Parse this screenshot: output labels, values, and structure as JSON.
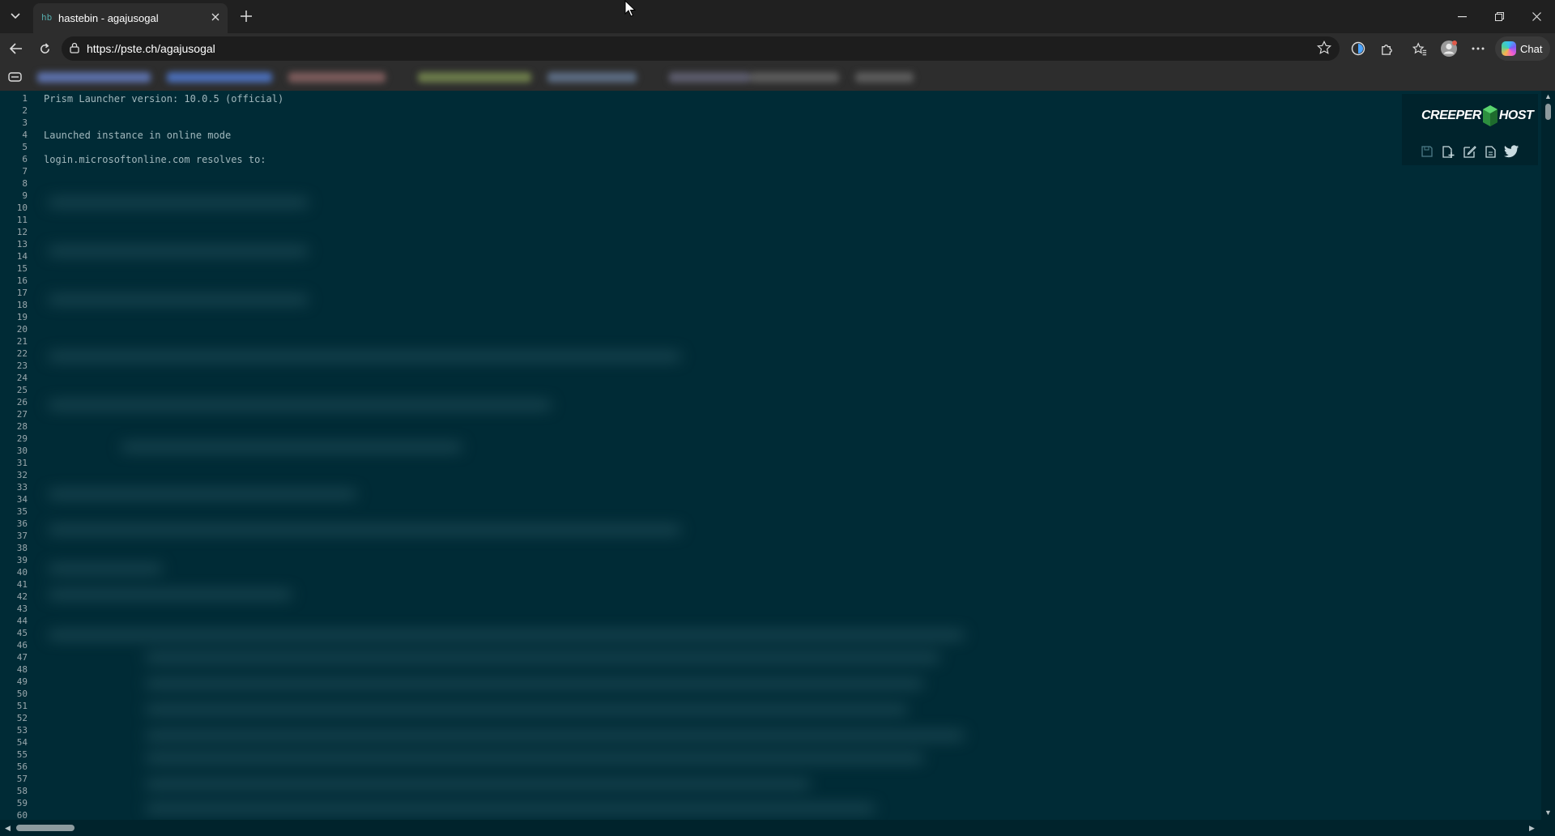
{
  "browser": {
    "tab_title": "hastebin - agajusogal",
    "tab_favicon_text": "hb",
    "url": "https://pste.ch/agajusogal",
    "copilot_label": "Chat"
  },
  "editor": {
    "visible_lines": [
      "Prism Launcher version: 10.0.5 (official)",
      "",
      "",
      "Launched instance in online mode",
      "",
      "login.microsoftonline.com resolves to:"
    ],
    "line_numbers": [
      "1",
      "2",
      "3",
      "4",
      "5",
      "6",
      "7",
      "8",
      "9",
      "10",
      "11",
      "12",
      "13",
      "14",
      "15",
      "16",
      "17",
      "18",
      "19",
      "20",
      "21",
      "22",
      "23",
      "24",
      "25",
      "26",
      "27",
      "28",
      "29",
      "30",
      "31",
      "32",
      "33",
      "34",
      "35",
      "36",
      "37",
      "38",
      "39",
      "40",
      "41",
      "42",
      "43",
      "44",
      "45",
      "46",
      "47",
      "48",
      "49",
      "50",
      "51",
      "52",
      "53",
      "54",
      "55",
      "56",
      "57",
      "58",
      "59",
      "60"
    ]
  },
  "brand": {
    "left": "CREEPER",
    "right": "HOST"
  },
  "icons": [
    "tab-actions-icon",
    "close-icon",
    "new-tab-icon",
    "minimize-icon",
    "restore-icon",
    "back-icon",
    "refresh-icon",
    "lock-icon",
    "favorite-star-icon",
    "extension-icon",
    "favorites-icon",
    "profile-icon",
    "more-icon",
    "copilot-icon",
    "save-icon",
    "new-icon",
    "edit-icon",
    "raw-icon",
    "twitter-icon"
  ],
  "colors": {
    "editor_bg": "#002b36",
    "chrome_bg": "#202020",
    "toolbar_bg": "#2d2d2d",
    "brand_green": "#3cc45a"
  }
}
